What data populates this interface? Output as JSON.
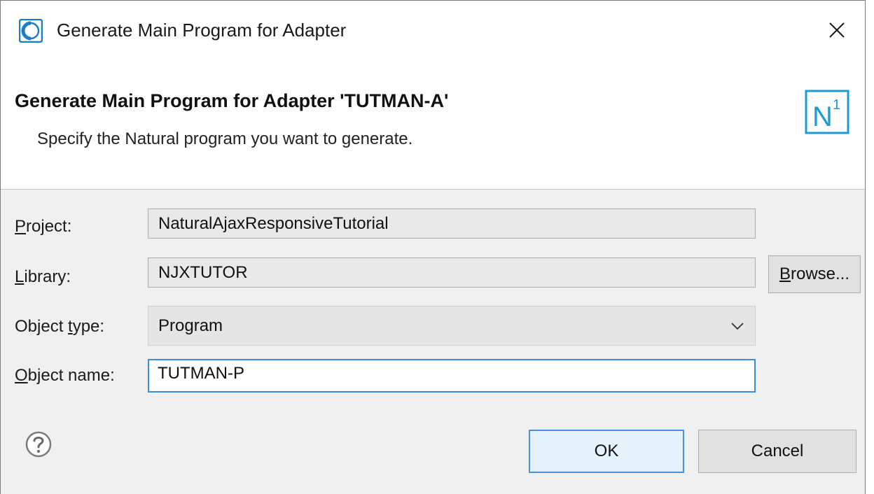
{
  "window": {
    "title": "Generate Main Program for Adapter"
  },
  "banner": {
    "title": "Generate Main Program for Adapter 'TUTMAN-A'",
    "description": "Specify the Natural program you want to generate.",
    "logo_text": "N",
    "logo_sup": "1"
  },
  "form": {
    "project": {
      "label_mnemonic": "P",
      "label_rest": "roject:",
      "value": "NaturalAjaxResponsiveTutorial"
    },
    "library": {
      "label_mnemonic": "L",
      "label_rest": "ibrary:",
      "value": "NJXTUTOR",
      "browse_mnemonic": "B",
      "browse_rest": "rowse..."
    },
    "object_type": {
      "label_pre": "Object ",
      "label_mnemonic": "t",
      "label_rest": "ype:",
      "value": "Program"
    },
    "object_name": {
      "label_mnemonic": "O",
      "label_rest": "bject name:",
      "value": "TUTMAN-P"
    }
  },
  "buttons": {
    "ok": "OK",
    "cancel": "Cancel"
  },
  "colors": {
    "accent": "#3a8ed8",
    "logo": "#1c9bd6"
  },
  "icons": [
    "app-icon",
    "close-icon",
    "n1-logo",
    "chevron-down-icon",
    "help-icon"
  ]
}
